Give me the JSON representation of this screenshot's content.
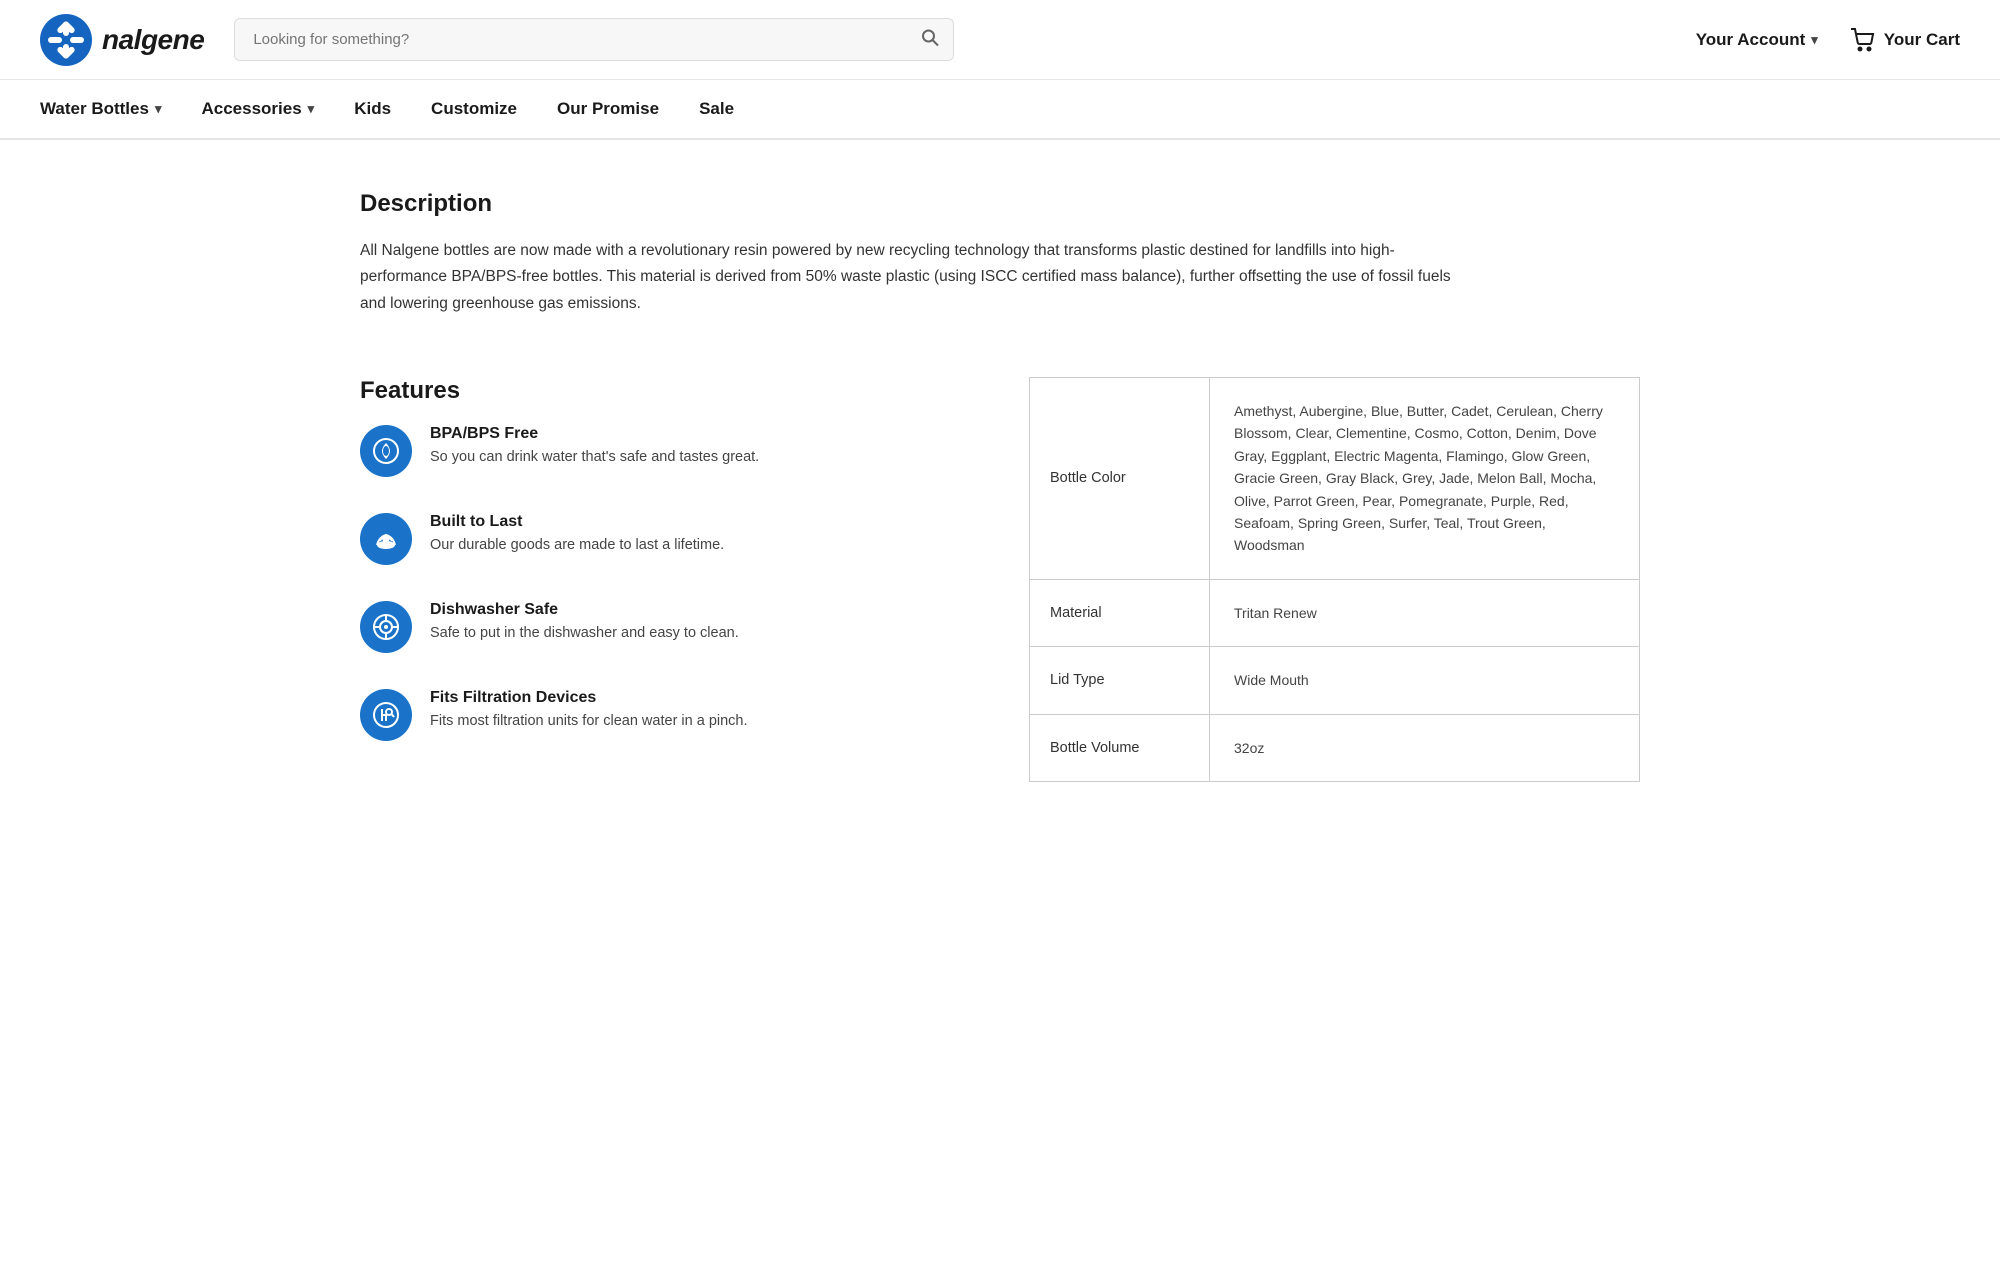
{
  "header": {
    "logo_text": "nalgene",
    "search_placeholder": "Looking for something?",
    "account_label": "Your Account",
    "cart_label": "Your Cart"
  },
  "nav": {
    "items": [
      {
        "label": "Water Bottles",
        "has_dropdown": true
      },
      {
        "label": "Accessories",
        "has_dropdown": true
      },
      {
        "label": "Kids",
        "has_dropdown": false
      },
      {
        "label": "Customize",
        "has_dropdown": false
      },
      {
        "label": "Our Promise",
        "has_dropdown": false
      },
      {
        "label": "Sale",
        "has_dropdown": false
      }
    ]
  },
  "description": {
    "title": "Description",
    "text": "All Nalgene bottles are now made with a revolutionary resin powered by new recycling technology that transforms plastic destined for landfills into high-performance BPA/BPS-free bottles. This material is derived from 50% waste plastic (using ISCC certified mass balance), further offsetting the use of fossil fuels and lowering greenhouse gas emissions."
  },
  "features": {
    "title": "Features",
    "items": [
      {
        "id": "bpa-free",
        "title": "BPA/BPS Free",
        "description": "So you can drink water that's safe and tastes great.",
        "icon": "💧"
      },
      {
        "id": "built-to-last",
        "title": "Built to Last",
        "description": "Our durable goods are made to last a lifetime.",
        "icon": "🐢"
      },
      {
        "id": "dishwasher-safe",
        "title": "Dishwasher Safe",
        "description": "Safe to put in the dishwasher and easy to clean.",
        "icon": "🧼"
      },
      {
        "id": "fits-filtration",
        "title": "Fits Filtration Devices",
        "description": "Fits most filtration units for clean water in a pinch.",
        "icon": "🔬"
      }
    ]
  },
  "specs": {
    "rows": [
      {
        "label": "Bottle Color",
        "value": "Amethyst, Aubergine, Blue, Butter, Cadet, Cerulean, Cherry Blossom, Clear, Clementine, Cosmo, Cotton, Denim, Dove Gray, Eggplant, Electric Magenta, Flamingo, Glow Green, Gracie Green, Gray Black, Grey, Jade, Melon Ball, Mocha, Olive, Parrot Green, Pear, Pomegranate, Purple, Red, Seafoam, Spring Green, Surfer, Teal, Trout Green, Woodsman"
      },
      {
        "label": "Material",
        "value": "Tritan Renew"
      },
      {
        "label": "Lid Type",
        "value": "Wide Mouth"
      },
      {
        "label": "Bottle Volume",
        "value": "32oz"
      }
    ]
  }
}
